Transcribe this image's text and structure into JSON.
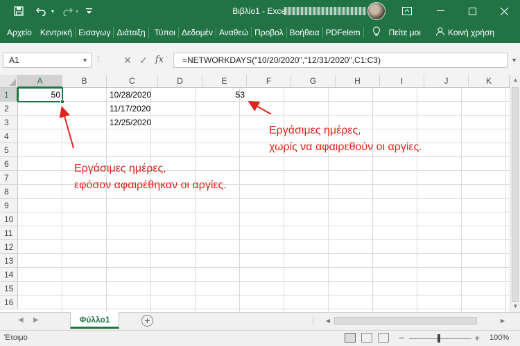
{
  "window": {
    "title": "Βιβλίο1  -  Excel",
    "controls": {
      "restore": "▭",
      "minimize": "—",
      "maximize": "☐",
      "close": "✕"
    }
  },
  "quick_access": {
    "save_icon": "floppy-disk-icon",
    "undo_icon": "undo-icon",
    "redo_icon": "redo-icon",
    "customize_icon": "chevron-down-icon"
  },
  "ribbon": {
    "tabs": [
      "Αρχείο",
      "Κεντρική",
      "Εισαγωγ",
      "Διάταξη",
      "Τύποι",
      "Δεδομέν",
      "Αναθεώ",
      "Προβολ",
      "Βοήθεια",
      "PDFelem"
    ],
    "tell_me": "Πείτε μοι",
    "share": "Κοινή χρήση"
  },
  "formula_bar": {
    "name_box": "A1",
    "cancel_glyph": "✕",
    "enter_glyph": "✓",
    "fx_label": "fx",
    "formula": "=NETWORKDAYS(\"10/20/2020\",\"12/31/2020\",C1:C3)"
  },
  "grid": {
    "columns": [
      "A",
      "B",
      "C",
      "D",
      "E",
      "F",
      "G",
      "H",
      "I",
      "J",
      "K"
    ],
    "rows": [
      "1",
      "2",
      "3",
      "4",
      "5",
      "6",
      "7",
      "8",
      "9",
      "10",
      "11",
      "12",
      "13",
      "14",
      "15",
      "16"
    ],
    "selected_cell": "A1",
    "cells": {
      "A1": "50",
      "C1": "10/28/2020",
      "C2": "11/17/2020",
      "C3": "12/25/2020",
      "E1": "53"
    }
  },
  "annotations": {
    "top_right": [
      "Εργάσιμες ημέρες,",
      "χωρίς να αφαιρεθούν οι αργίες."
    ],
    "left": [
      "Εργάσιμες ημέρες,",
      "εφόσον αφαιρέθηκαν οι αργίες."
    ],
    "color": "#e0221c"
  },
  "sheets": {
    "tabs": [
      "Φύλλο1"
    ],
    "active": "Φύλλο1",
    "add_label": "+"
  },
  "status_bar": {
    "status": "Έτοιμο",
    "zoom_minus": "−",
    "zoom_plus": "+",
    "zoom": "100%"
  },
  "colors": {
    "accent": "#217346",
    "title_bar": "#217346"
  }
}
